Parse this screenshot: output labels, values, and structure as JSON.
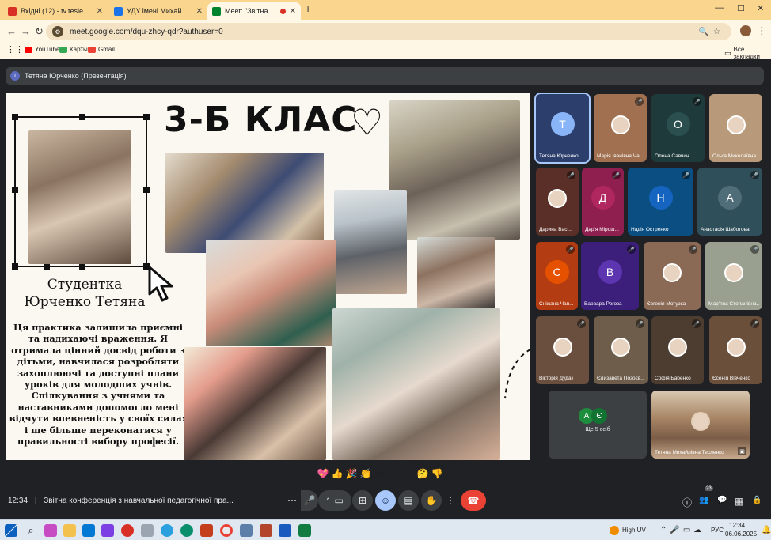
{
  "browser": {
    "tabs": [
      {
        "title": "Вхідні (12) - tv.teslenko@npu.edu.ua",
        "color": "#d93025"
      },
      {
        "title": "УДУ імені Михайла Драгоманова",
        "color": "#1a73e8"
      },
      {
        "title": "Meet: \"Звітна конференція\"",
        "color": "#00832d",
        "active": true
      }
    ],
    "new_tab": "+",
    "url": "meet.google.com/dqu-zhcy-qdr?authuser=0",
    "bookmarks": [
      {
        "label": "YouTube",
        "color": "#ff0000"
      },
      {
        "label": "Карты",
        "color": "#34a853"
      },
      {
        "label": "Gmail",
        "color": "#ea4335"
      }
    ],
    "all_bookmarks": "Все закладки"
  },
  "meet": {
    "presenter_banner": "Тетяна Юрченко (Презентація)",
    "presenter_initial": "Т",
    "slide": {
      "title": "3-Б КЛАС",
      "heart_symbol": "♡",
      "student_heading_line1": "Студентка",
      "student_heading_line2": "Юрченко Тетяна",
      "student_text": "Ця практика залишила приємні та надихаючі враження. Я отримала цінний досвід роботи з дітьми, навчилася розробляти захоплюючі та доступні плани уроків для молодших учнів. Спілкування з учнями та наставниками допомогло мені відчути впевненість у своїх силах і ще більше переконатися у правильності вибору професії."
    },
    "participants": [
      {
        "name": "Тетяна Юрченко",
        "initial": "Т",
        "bg": "#2c3e6b",
        "badge": "#8ab4f8",
        "muted": false
      },
      {
        "name": "Марія Іванівна Ча...",
        "bg": "#a07050",
        "muted": true
      },
      {
        "name": "Олена Савчин",
        "initial": "О",
        "bg": "#1f3a3a",
        "badge": "#2b4f4f",
        "muted": true
      },
      {
        "name": "Ольга Миколаївна...",
        "bg": "#b89a7a",
        "muted": false
      },
      {
        "name": "Дарина Вас...",
        "bg": "#5a2f27",
        "muted": true
      },
      {
        "name": "Дар'я Мірош...",
        "initial": "Д",
        "bg": "#8e1f4f",
        "badge": "#b0265f",
        "muted": true
      },
      {
        "name": "Надія Остренко",
        "initial": "Н",
        "bg": "#0b4f82",
        "badge": "#1565c0",
        "muted": true
      },
      {
        "name": "Анастасія Шаботова",
        "initial": "А",
        "bg": "#2f4f5a",
        "badge": "#4f6d78",
        "muted": true
      },
      {
        "name": "Сніжана Чап...",
        "initial": "С",
        "bg": "#b43c12",
        "badge": "#e65100",
        "muted": true
      },
      {
        "name": "Варвара Рогоза",
        "initial": "В",
        "bg": "#3b1f7a",
        "badge": "#5e35b1",
        "muted": true
      },
      {
        "name": "Євгенія Мотузка",
        "bg": "#8a6a55",
        "muted": true
      },
      {
        "name": "Мар'яна Степанівна...",
        "bg": "#9aa08f",
        "muted": true
      },
      {
        "name": "Вікторія Дудак",
        "bg": "#6b4f3e",
        "muted": true
      },
      {
        "name": "Єлизавета Позоєв...",
        "bg": "#6e5d4a",
        "muted": true
      },
      {
        "name": "Софія Бабенко",
        "bg": "#4d3d30",
        "muted": true
      },
      {
        "name": "Єсенія Вівченко",
        "bg": "#6a4f3b",
        "muted": true
      }
    ],
    "more": {
      "label": "Ще 5 осіб",
      "initials": [
        "А",
        "Є"
      ],
      "colors": [
        "#1e8e3e",
        "#137333"
      ]
    },
    "self": {
      "name": "Тетяна Михайлівна Тесленко",
      "bg": "#b39073"
    },
    "reactions": [
      "💖",
      "👍",
      "🎉",
      "👏",
      "😂",
      "😮",
      "😢",
      "🤔",
      "👎"
    ],
    "time": "12:34",
    "meeting_title": "Звітна конференція з навчальної педагогічної пра...",
    "participants_count": "23",
    "controls": {
      "more_options": "⋯",
      "mic": "🎤",
      "chevron": "^",
      "camera": "▭",
      "present": "⊞",
      "emoji": "☺",
      "captions": "▤",
      "raise_hand": "✋",
      "overflow": "⋮",
      "end_call": "☎",
      "info": "ⓘ",
      "people": "👥",
      "chat": "💬",
      "activities": "▦",
      "lock": "🔒"
    }
  },
  "taskbar": {
    "weather": "High UV",
    "lang": "РУС",
    "time": "12:34",
    "date": "06.06.2025"
  }
}
